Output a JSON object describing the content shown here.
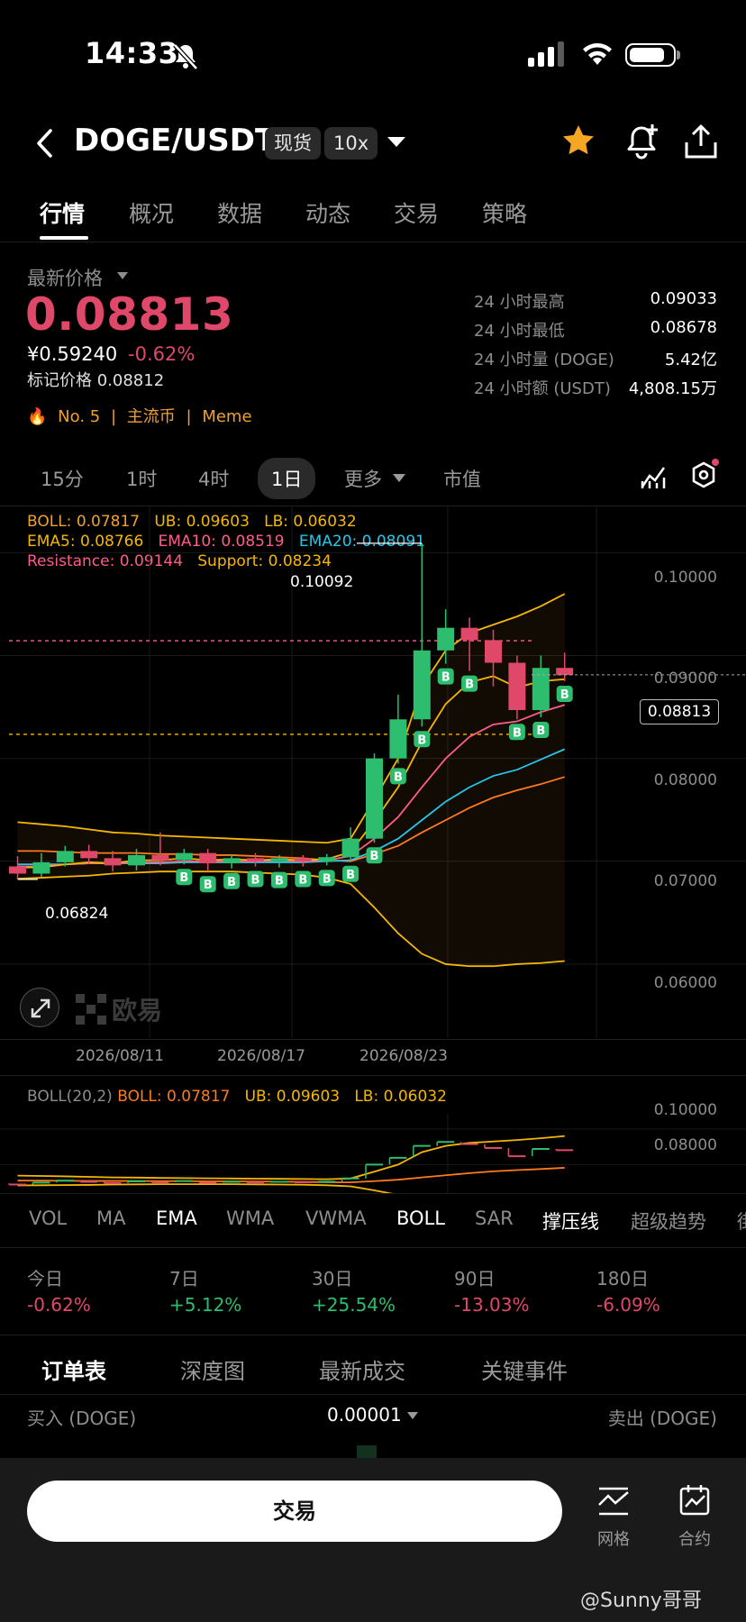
{
  "status": {
    "time": "14:33"
  },
  "header": {
    "pair": "DOGE/USDT",
    "spot_tag": "现货",
    "leverage_tag": "10x"
  },
  "tabs": [
    "行情",
    "概况",
    "数据",
    "动态",
    "交易",
    "策略"
  ],
  "price": {
    "label": "最新价格",
    "last": "0.08813",
    "cny": "¥0.59240",
    "change": "-0.62%",
    "mark": "标记价格 0.08812",
    "rank": "No. 5",
    "category": "主流币",
    "tag": "Meme",
    "sep": "|"
  },
  "stats": [
    {
      "label": "24 小时最高",
      "value": "0.09033"
    },
    {
      "label": "24 小时最低",
      "value": "0.08678"
    },
    {
      "label": "24 小时量 (DOGE)",
      "value": "5.42亿"
    },
    {
      "label": "24 小时额 (USDT)",
      "value": "4,808.15万"
    }
  ],
  "timeframes": [
    "15分",
    "1时",
    "4时",
    "1日",
    "更多",
    "市值"
  ],
  "indicators": {
    "boll": "BOLL: 0.07817",
    "ub": "UB: 0.09603",
    "lb": "LB: 0.06032",
    "ema5": "EMA5: 0.08766",
    "ema10": "EMA10: 0.08519",
    "ema20": "EMA20: 0.08091",
    "resistance": "Resistance: 0.09144",
    "support": "Support: 0.08234"
  },
  "colors": {
    "up": "#2dbd6e",
    "down": "#e0486a",
    "boll": "#f0a030",
    "ema10": "#ff5c8a",
    "ema20": "#29c5e6"
  },
  "chart_data": {
    "type": "line",
    "y_ticks": [
      "0.10000",
      "0.09000",
      "0.08000",
      "0.07000",
      "0.06000"
    ],
    "ylim": [
      0.055,
      0.1045
    ],
    "x_labels": [
      "2026/08/11",
      "2026/08/17",
      "2026/08/23"
    ],
    "high_label": "0.10092",
    "low_label": "0.06824",
    "current_label": "0.08813",
    "resistance": 0.09144,
    "support": 0.08234,
    "candles": [
      [
        0.0695,
        0.0688,
        0.0705,
        0.0682
      ],
      [
        0.0688,
        0.0699,
        0.0708,
        0.0685
      ],
      [
        0.0699,
        0.071,
        0.0715,
        0.0695
      ],
      [
        0.071,
        0.0703,
        0.0716,
        0.0698
      ],
      [
        0.0703,
        0.0696,
        0.071,
        0.069
      ],
      [
        0.0696,
        0.0706,
        0.0712,
        0.0691
      ],
      [
        0.0706,
        0.0701,
        0.0728,
        0.0696
      ],
      [
        0.0701,
        0.0708,
        0.0712,
        0.0697
      ],
      [
        0.0708,
        0.0698,
        0.0712,
        0.069
      ],
      [
        0.0698,
        0.0703,
        0.0707,
        0.0693
      ],
      [
        0.0703,
        0.07,
        0.0708,
        0.0695
      ],
      [
        0.07,
        0.0703,
        0.0706,
        0.0694
      ],
      [
        0.0703,
        0.07,
        0.0706,
        0.0695
      ],
      [
        0.07,
        0.0704,
        0.0707,
        0.0696
      ],
      [
        0.0704,
        0.0722,
        0.0733,
        0.07
      ],
      [
        0.0722,
        0.08,
        0.0805,
        0.0718
      ],
      [
        0.08,
        0.0838,
        0.0862,
        0.0795
      ],
      [
        0.0838,
        0.0905,
        0.1009,
        0.0831
      ],
      [
        0.0905,
        0.0927,
        0.0945,
        0.0892
      ],
      [
        0.0927,
        0.0915,
        0.0937,
        0.0885
      ],
      [
        0.0915,
        0.0893,
        0.0925,
        0.087
      ],
      [
        0.0893,
        0.0847,
        0.09,
        0.0838
      ],
      [
        0.0847,
        0.0888,
        0.09,
        0.084
      ],
      [
        0.0888,
        0.0881,
        0.0903,
        0.0875
      ]
    ],
    "ub": [
      0.0738,
      0.0736,
      0.0734,
      0.0731,
      0.0728,
      0.0727,
      0.0725,
      0.0724,
      0.0723,
      0.0722,
      0.0721,
      0.072,
      0.0719,
      0.0718,
      0.0722,
      0.076,
      0.08,
      0.087,
      0.0905,
      0.0922,
      0.093,
      0.0938,
      0.0948,
      0.096
    ],
    "lb": [
      0.0683,
      0.0684,
      0.0685,
      0.0686,
      0.0688,
      0.0689,
      0.069,
      0.069,
      0.069,
      0.069,
      0.0689,
      0.0688,
      0.0687,
      0.0684,
      0.0678,
      0.0655,
      0.063,
      0.061,
      0.06,
      0.0598,
      0.0598,
      0.06,
      0.0601,
      0.0603
    ],
    "ema5": [
      0.0694,
      0.0694,
      0.0697,
      0.0699,
      0.0698,
      0.0701,
      0.0701,
      0.0703,
      0.0701,
      0.0702,
      0.0701,
      0.0702,
      0.0701,
      0.0702,
      0.0709,
      0.0739,
      0.0772,
      0.0816,
      0.0853,
      0.0874,
      0.088,
      0.0869,
      0.0875,
      0.0877
    ],
    "ema10": [
      0.0695,
      0.0695,
      0.0697,
      0.0698,
      0.0698,
      0.0699,
      0.0699,
      0.07,
      0.07,
      0.07,
      0.07,
      0.0701,
      0.07,
      0.0701,
      0.0705,
      0.0722,
      0.0743,
      0.0772,
      0.08,
      0.0821,
      0.0833,
      0.0836,
      0.0845,
      0.0852
    ],
    "ema20": [
      0.0697,
      0.0697,
      0.0697,
      0.0698,
      0.0698,
      0.0698,
      0.0698,
      0.0699,
      0.0699,
      0.0699,
      0.0699,
      0.0699,
      0.0699,
      0.07,
      0.0701,
      0.071,
      0.0722,
      0.074,
      0.0758,
      0.0772,
      0.0783,
      0.0789,
      0.0799,
      0.0809
    ],
    "boll_mid": [
      0.071,
      0.071,
      0.0709,
      0.0708,
      0.0708,
      0.0708,
      0.0707,
      0.0707,
      0.0706,
      0.0706,
      0.0705,
      0.0704,
      0.0703,
      0.0701,
      0.07,
      0.0707,
      0.0715,
      0.0728,
      0.074,
      0.0752,
      0.0762,
      0.0769,
      0.0775,
      0.0782
    ],
    "buy_signals": [
      7,
      8,
      9,
      10,
      11,
      12,
      13,
      14,
      15,
      16,
      17,
      18,
      19,
      21,
      22,
      23
    ],
    "sub_chart": {
      "label": "BOLL(20,2)",
      "boll": "BOLL: 0.07817",
      "ub": "UB: 0.09603",
      "lb": "LB: 0.06032",
      "y_ticks": [
        "0.10000",
        "0.08000"
      ]
    }
  },
  "brand": "欧易",
  "indicator_tabs": [
    "VOL",
    "MA",
    "EMA",
    "WMA",
    "VWMA",
    "BOLL",
    "SAR",
    "撑压线",
    "超级趋势",
    "街"
  ],
  "performance": [
    {
      "label": "今日",
      "value": "-0.62%",
      "dir": "down"
    },
    {
      "label": "7日",
      "value": "+5.12%",
      "dir": "up"
    },
    {
      "label": "30日",
      "value": "+25.54%",
      "dir": "up"
    },
    {
      "label": "90日",
      "value": "-13.03%",
      "dir": "down"
    },
    {
      "label": "180日",
      "value": "-6.09%",
      "dir": "down"
    }
  ],
  "orderbook": {
    "tabs": [
      "订单表",
      "深度图",
      "最新成交",
      "关键事件"
    ],
    "buy": "买入 (DOGE)",
    "precision": "0.00001",
    "sell": "卖出 (DOGE)"
  },
  "bottom": {
    "trade": "交易",
    "grid": "网格",
    "contract": "合约"
  },
  "watermark": "@Sunny哥哥"
}
